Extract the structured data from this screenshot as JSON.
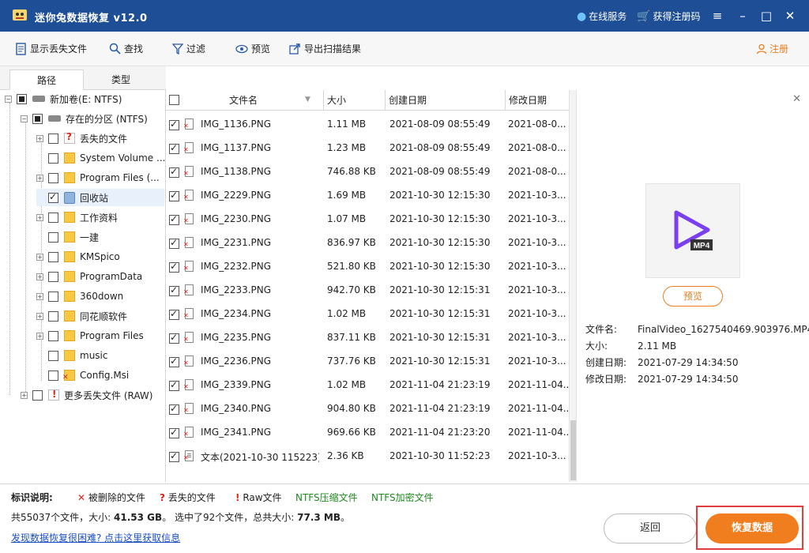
{
  "window": {
    "title": "迷你兔数据恢复 v12.0",
    "online_service": "在线服务",
    "get_code": "获得注册码"
  },
  "toolbar": {
    "show_lost": "显示丢失文件",
    "find": "查找",
    "filter": "过滤",
    "preview": "预览",
    "export": "导出扫描结果",
    "register": "注册"
  },
  "left_tabs": {
    "path": "路径",
    "type": "类型"
  },
  "tree": [
    {
      "label": "新加卷(E: NTFS)"
    },
    {
      "label": "存在的分区 (NTFS)"
    },
    {
      "label": "丢失的文件"
    },
    {
      "label": "System Volume ..."
    },
    {
      "label": "Program Files (..."
    },
    {
      "label": "回收站"
    },
    {
      "label": "工作资料"
    },
    {
      "label": "一建"
    },
    {
      "label": "KMSpico"
    },
    {
      "label": "ProgramData"
    },
    {
      "label": "360down"
    },
    {
      "label": "同花顺软件"
    },
    {
      "label": "Program Files"
    },
    {
      "label": "music"
    },
    {
      "label": "Config.Msi"
    },
    {
      "label": "更多丢失文件 (RAW)"
    }
  ],
  "columns": {
    "name": "文件名",
    "size": "大小",
    "created": "创建日期",
    "modified": "修改日期"
  },
  "files": [
    {
      "name": "IMG_1136.PNG",
      "size": "1.11 MB",
      "created": "2021-08-09 08:55:49",
      "modified": "2021-08-0..."
    },
    {
      "name": "IMG_1137.PNG",
      "size": "1.23 MB",
      "created": "2021-08-09 08:55:49",
      "modified": "2021-08-0..."
    },
    {
      "name": "IMG_1138.PNG",
      "size": "746.88 KB",
      "created": "2021-08-09 08:55:49",
      "modified": "2021-08-0..."
    },
    {
      "name": "IMG_2229.PNG",
      "size": "1.69 MB",
      "created": "2021-10-30 12:15:30",
      "modified": "2021-10-3..."
    },
    {
      "name": "IMG_2230.PNG",
      "size": "1.07 MB",
      "created": "2021-10-30 12:15:30",
      "modified": "2021-10-3..."
    },
    {
      "name": "IMG_2231.PNG",
      "size": "836.97 KB",
      "created": "2021-10-30 12:15:30",
      "modified": "2021-10-3..."
    },
    {
      "name": "IMG_2232.PNG",
      "size": "521.80 KB",
      "created": "2021-10-30 12:15:30",
      "modified": "2021-10-3..."
    },
    {
      "name": "IMG_2233.PNG",
      "size": "942.70 KB",
      "created": "2021-10-30 12:15:31",
      "modified": "2021-10-3..."
    },
    {
      "name": "IMG_2234.PNG",
      "size": "1.02 MB",
      "created": "2021-10-30 12:15:31",
      "modified": "2021-10-3..."
    },
    {
      "name": "IMG_2235.PNG",
      "size": "837.11 KB",
      "created": "2021-10-30 12:15:31",
      "modified": "2021-10-3..."
    },
    {
      "name": "IMG_2236.PNG",
      "size": "737.76 KB",
      "created": "2021-10-30 12:15:31",
      "modified": "2021-10-3..."
    },
    {
      "name": "IMG_2339.PNG",
      "size": "1.02 MB",
      "created": "2021-11-04 21:23:19",
      "modified": "2021-11-04..."
    },
    {
      "name": "IMG_2340.PNG",
      "size": "904.80 KB",
      "created": "2021-11-04 21:23:19",
      "modified": "2021-11-04..."
    },
    {
      "name": "IMG_2341.PNG",
      "size": "969.66 KB",
      "created": "2021-11-04 21:23:20",
      "modified": "2021-11-04..."
    },
    {
      "name": "文本(2021-10-30 115223)...",
      "size": "2.36 KB",
      "created": "2021-10-30 11:52:23",
      "modified": "2021-10-3..."
    }
  ],
  "preview": {
    "badge": "MP4",
    "button": "预览",
    "filename_label": "文件名:",
    "filename": "FinalVideo_1627540469.903976.MP4",
    "size_label": "大小:",
    "size": "2.11 MB",
    "created_label": "创建日期:",
    "created": "2021-07-29 14:34:50",
    "modified_label": "修改日期:",
    "modified": "2021-07-29 14:34:50"
  },
  "legend": {
    "title": "标识说明:",
    "deleted": "被删除的文件",
    "lost": "丢失的文件",
    "raw": "Raw文件",
    "ntfs_compressed": "NTFS压缩文件",
    "ntfs_encrypted": "NTFS加密文件"
  },
  "status": {
    "prefix": "共55037个文件，大小: ",
    "total_size": "41.53 GB",
    "middle": "。 选中了92个文件，总共大小: ",
    "selected_size": "77.3 MB",
    "suffix": "。"
  },
  "help_link": "发现数据恢复很困难? 点击这里获取信息",
  "buttons": {
    "back": "返回",
    "recover": "恢复数据"
  },
  "colors": {
    "titlebar": "#1e4f96",
    "accent": "#f07d1e",
    "deleted": "#e2231a",
    "ntfs": "#1d8a1d"
  }
}
